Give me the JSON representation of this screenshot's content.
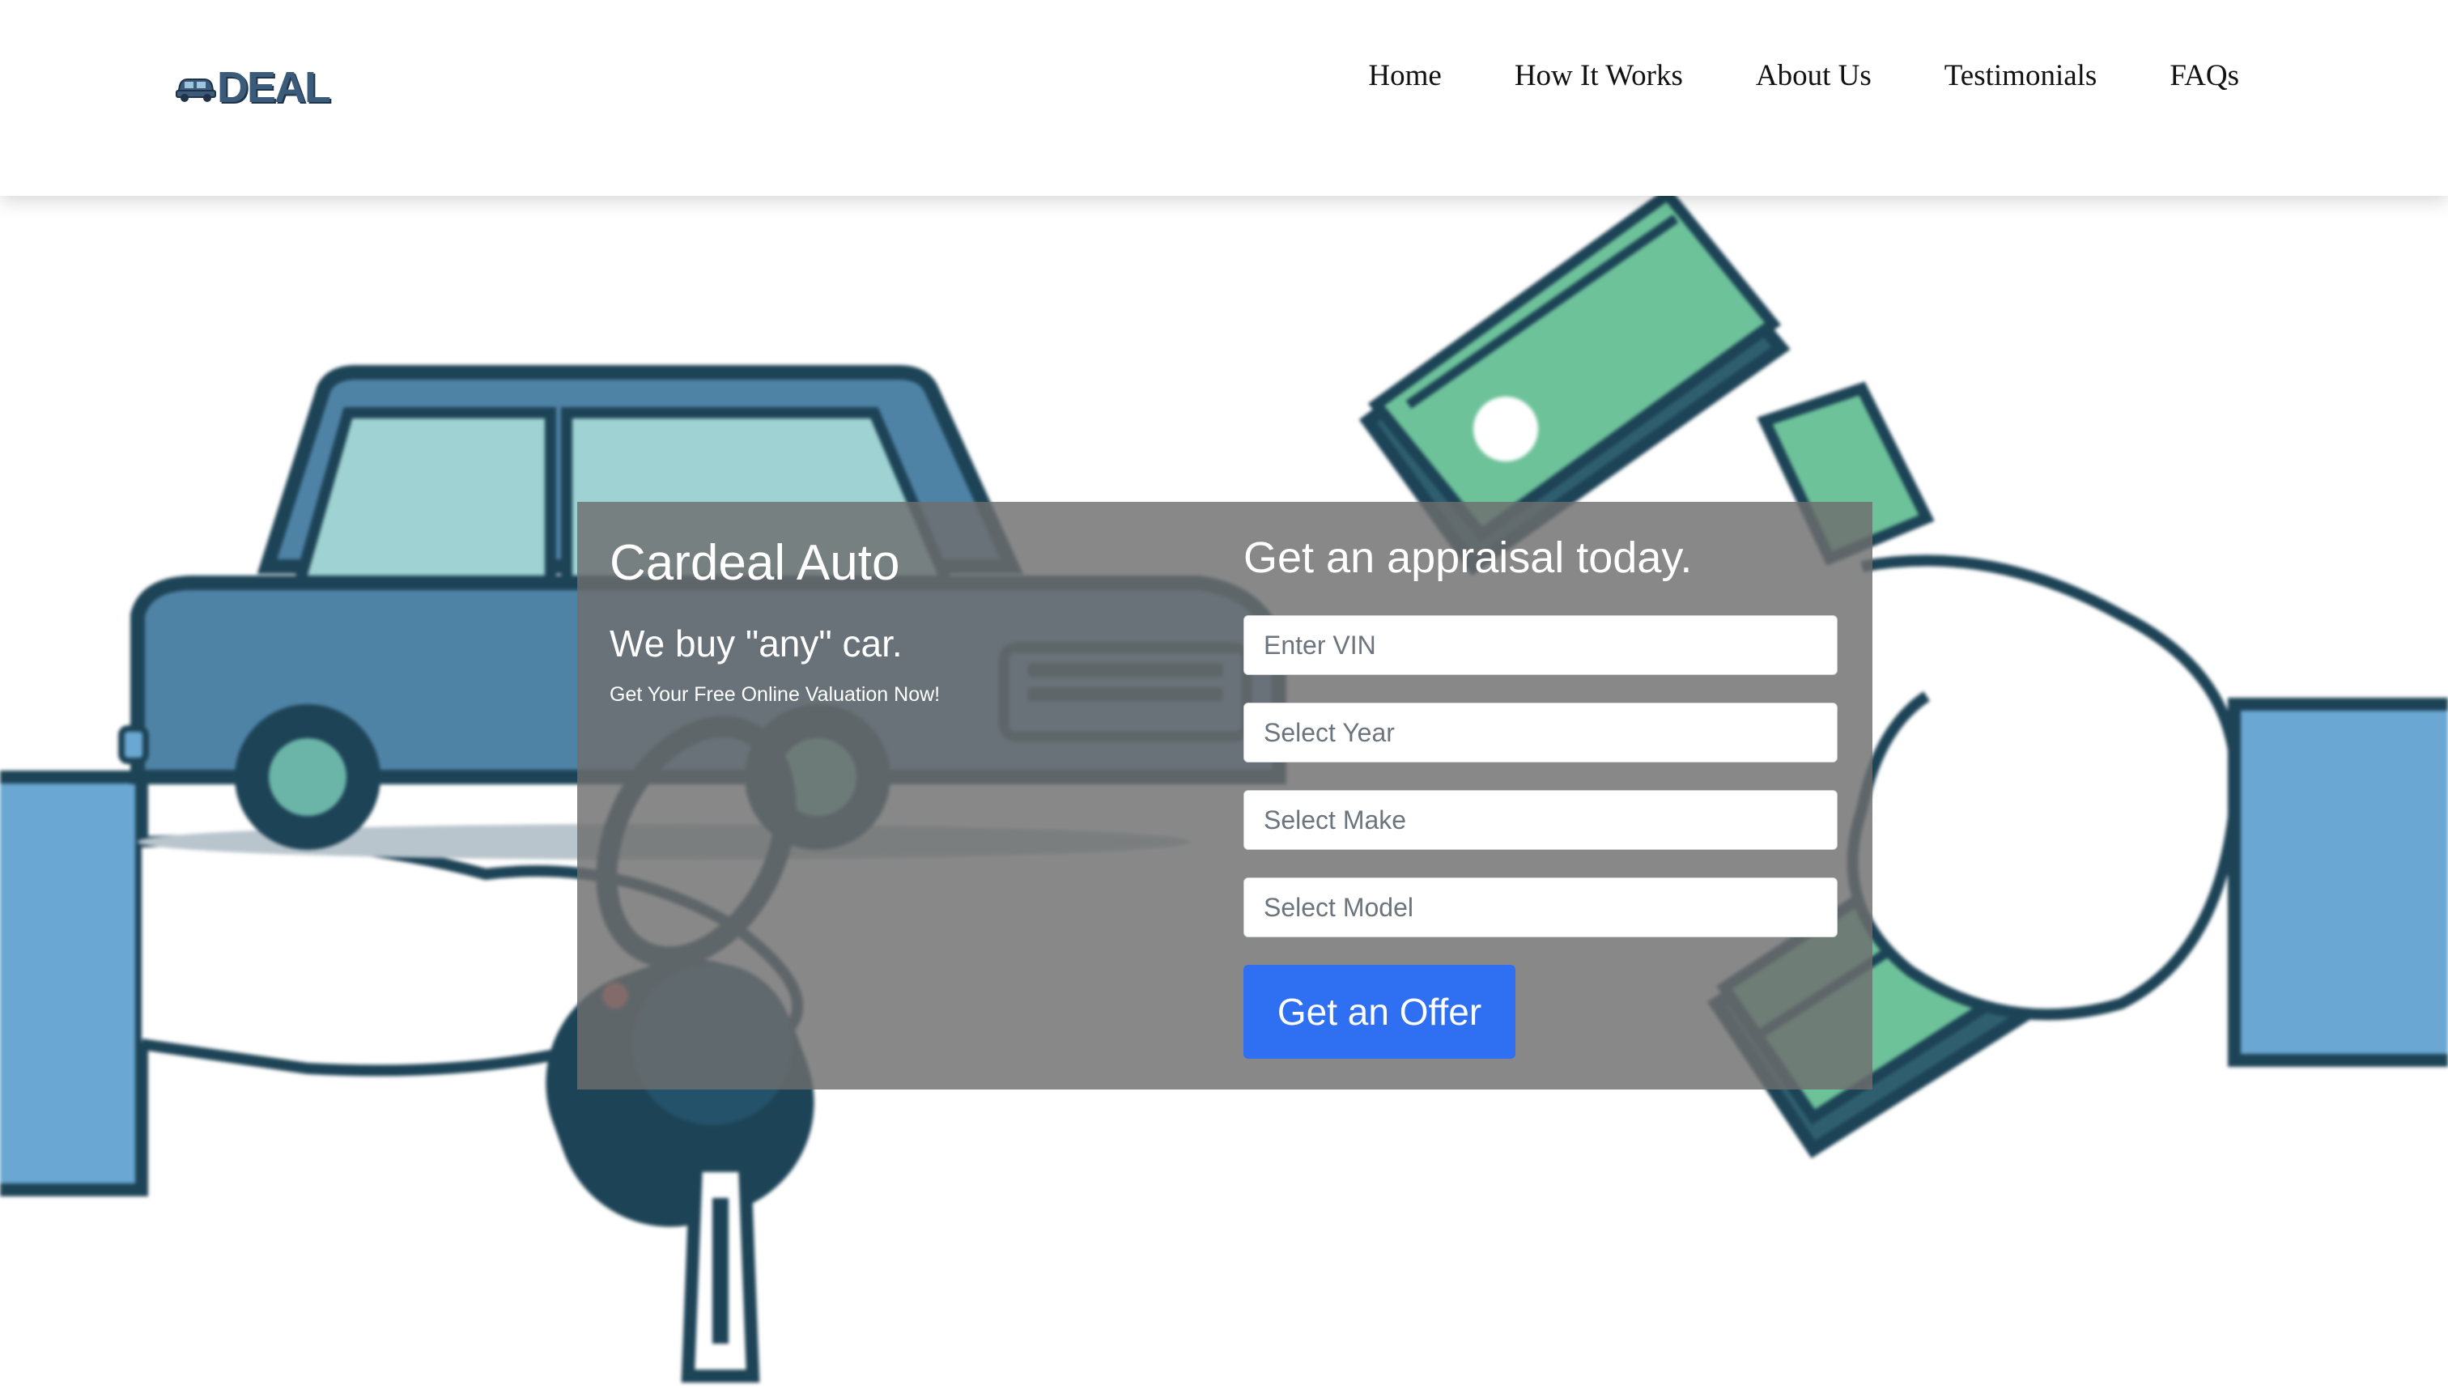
{
  "header": {
    "logo_text": "DEAL",
    "nav": [
      {
        "label": "Home"
      },
      {
        "label": "How It Works"
      },
      {
        "label": "About Us"
      },
      {
        "label": "Testimonials"
      },
      {
        "label": "FAQs"
      }
    ]
  },
  "hero": {
    "brand_title": "Cardeal Auto",
    "tagline": "We buy \"any\" car.",
    "subline": "Get Your Free Online Valuation Now!",
    "form_title": "Get an appraisal today.",
    "fields": {
      "vin": {
        "placeholder": "Enter VIN"
      },
      "year": {
        "placeholder": "Select Year"
      },
      "make": {
        "placeholder": "Select Make"
      },
      "model": {
        "placeholder": "Select Model"
      }
    },
    "submit_label": "Get an Offer"
  },
  "colors": {
    "primary_button": "#2f6ff2",
    "panel_overlay": "#6e6e6e",
    "logo": "#3b5b7a"
  }
}
